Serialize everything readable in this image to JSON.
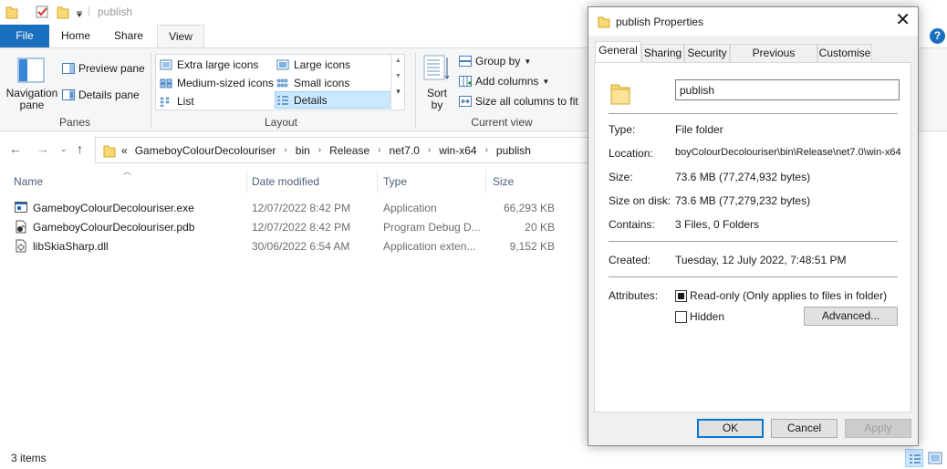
{
  "explorer": {
    "title": "publish",
    "tabs": {
      "file": "File",
      "home": "Home",
      "share": "Share",
      "view": "View"
    },
    "help": "?",
    "ribbon": {
      "panes": {
        "navigation_pane": "Navigation pane",
        "preview_pane": "Preview pane",
        "details_pane": "Details pane",
        "group_label": "Panes"
      },
      "layout": {
        "extra_large_icons": "Extra large icons",
        "large_icons": "Large icons",
        "medium_icons": "Medium-sized icons",
        "small_icons": "Small icons",
        "list": "List",
        "details": "Details",
        "group_label": "Layout"
      },
      "current_view": {
        "sort_by": "Sort by",
        "group_by": "Group by",
        "add_columns": "Add columns",
        "size_all_columns": "Size all columns to fit",
        "group_label": "Current view"
      }
    },
    "breadcrumb": {
      "overflow": "«",
      "parts": [
        "GameboyColourDecolouriser",
        "bin",
        "Release",
        "net7.0",
        "win-x64",
        "publish"
      ]
    },
    "columns": {
      "name": "Name",
      "date": "Date modified",
      "type": "Type",
      "size": "Size"
    },
    "files": [
      {
        "name": "GameboyColourDecolouriser.exe",
        "date": "12/07/2022 8:42 PM",
        "type": "Application",
        "size": "66,293 KB",
        "icon": "exe-icon"
      },
      {
        "name": "GameboyColourDecolouriser.pdb",
        "date": "12/07/2022 8:42 PM",
        "type": "Program Debug D...",
        "size": "20 KB",
        "icon": "pdb-icon"
      },
      {
        "name": "libSkiaSharp.dll",
        "date": "30/06/2022 6:54 AM",
        "type": "Application exten...",
        "size": "9,152 KB",
        "icon": "dll-icon"
      }
    ],
    "status": "3 items"
  },
  "dialog": {
    "title": "publish Properties",
    "tabs": [
      "General",
      "Sharing",
      "Security",
      "Previous Versions",
      "Customise"
    ],
    "name": "publish",
    "fields": {
      "type_label": "Type:",
      "type": "File folder",
      "location_label": "Location:",
      "location": "boyColourDecolouriser\\bin\\Release\\net7.0\\win-x64",
      "size_label": "Size:",
      "size": "73.6 MB (77,274,932 bytes)",
      "size_on_disk_label": "Size on disk:",
      "size_on_disk": "73.6 MB (77,279,232 bytes)",
      "contains_label": "Contains:",
      "contains": "3 Files, 0 Folders",
      "created_label": "Created:",
      "created": "Tuesday, 12 July 2022, 7:48:51 PM",
      "attributes_label": "Attributes:"
    },
    "attributes": {
      "readonly": "Read-only (Only applies to files in folder)",
      "hidden": "Hidden",
      "advanced": "Advanced..."
    },
    "buttons": {
      "ok": "OK",
      "cancel": "Cancel",
      "apply": "Apply"
    }
  },
  "colors": {
    "accent": "#1a6fbf",
    "folder": "#f8d775",
    "selection": "#cce8ff"
  }
}
